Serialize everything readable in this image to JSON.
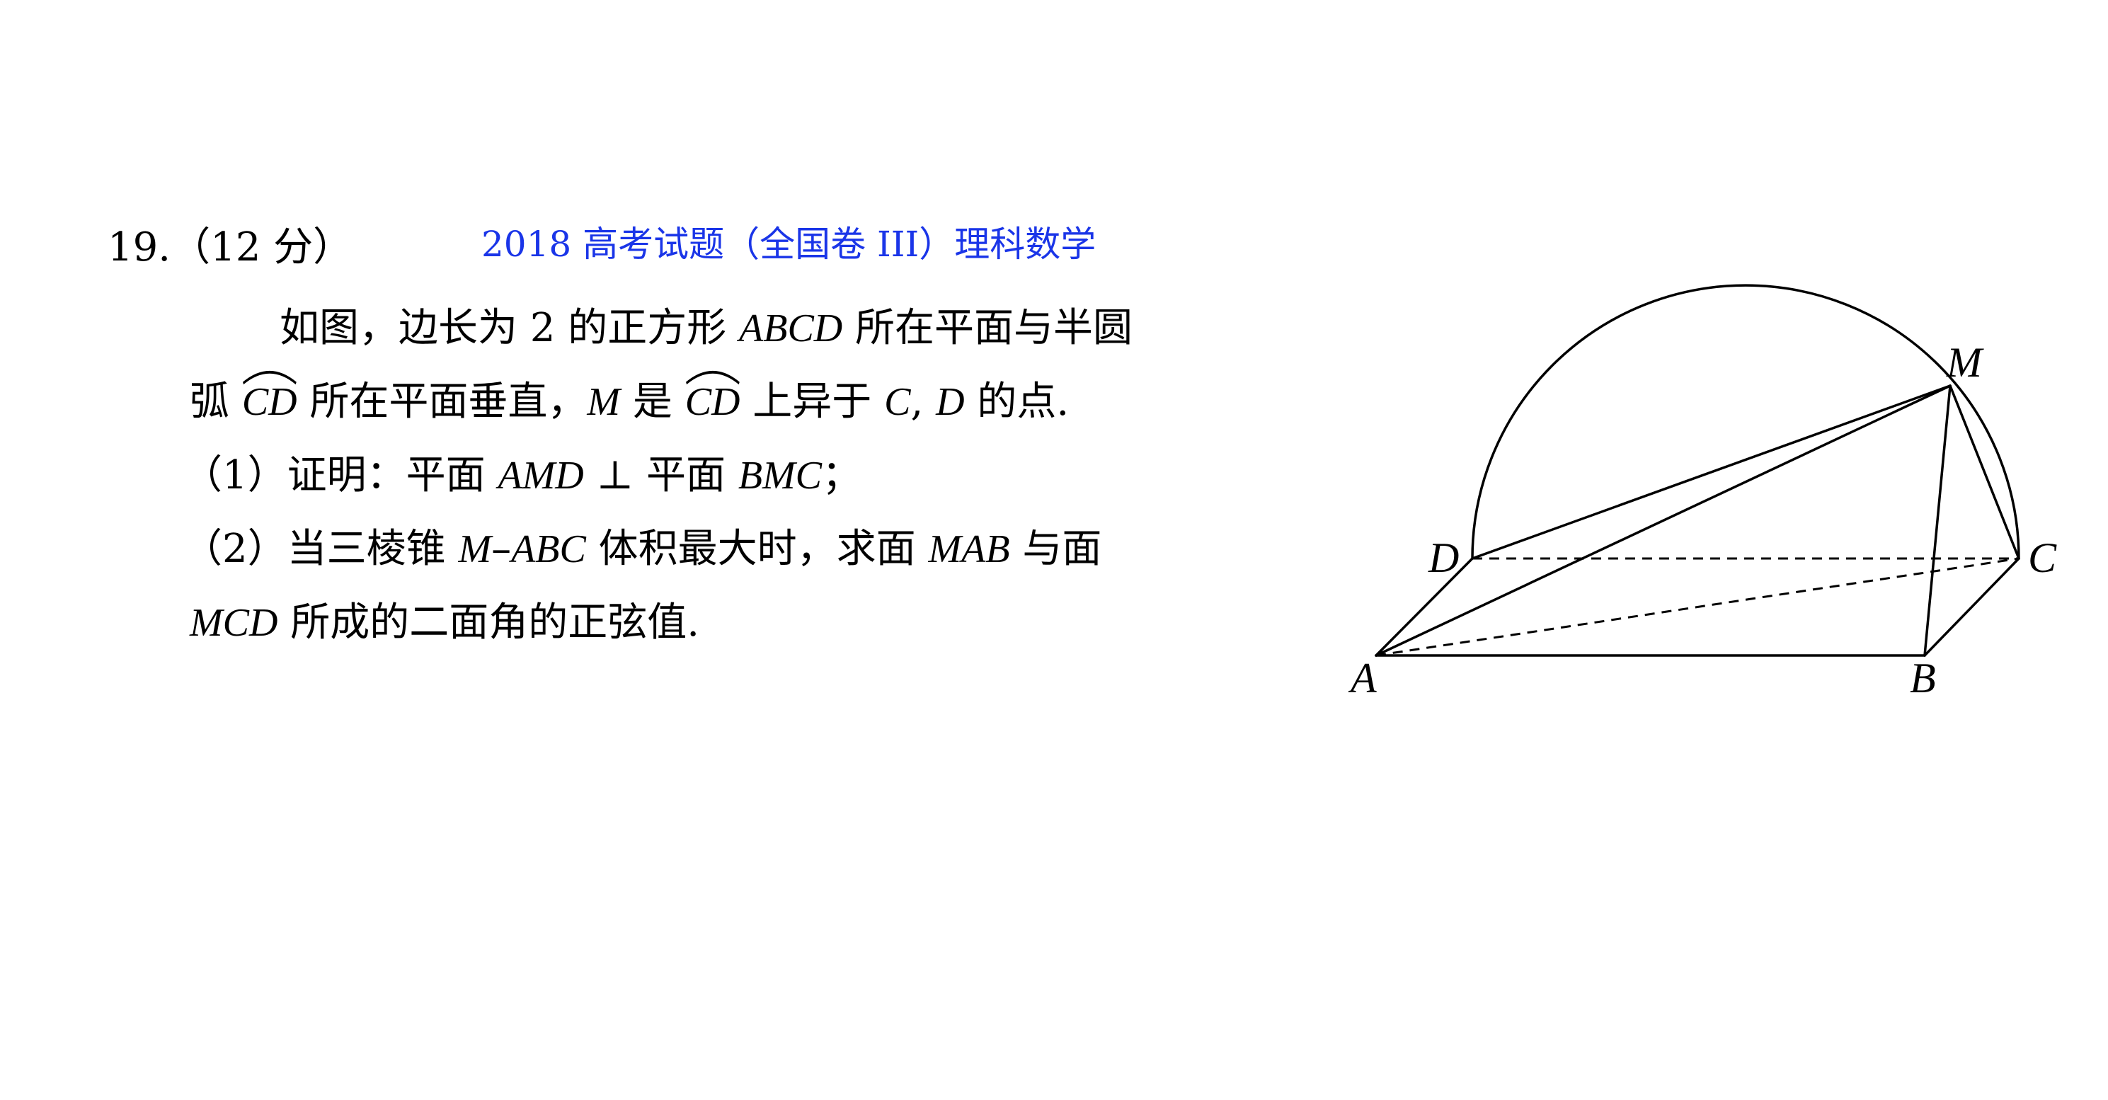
{
  "problem": {
    "number": "19.",
    "points": "（12 分）",
    "source": "2018 高考试题（全国卷 III）理科数学"
  },
  "statement": {
    "l1_a": "如图，边长为 2 的正方形 ",
    "l1_b": "ABCD",
    "l1_c": " 所在平面与半圆",
    "l2_a": "弧 ",
    "l2_b": "CD",
    "l2_c": " 所在平面垂直，",
    "l2_d": "M",
    "l2_e": " 是 ",
    "l2_f": "CD",
    "l2_g": " 上异于 ",
    "l2_h": "C",
    "l2_i": ", ",
    "l2_j": "D",
    "l2_k": " 的点."
  },
  "part1": {
    "a": "（1）证明：平面 ",
    "b": "AMD",
    "c": " ⊥ 平面 ",
    "d": "BMC",
    "e": "；"
  },
  "part2": {
    "a": "（2）当三棱锥 ",
    "b": "M",
    "c": "–",
    "d": "ABC",
    "e": " 体积最大时，求面 ",
    "f": "MAB",
    "g": " 与面",
    "h": "MCD",
    "i": " 所成的二面角的正弦值."
  },
  "figure_labels": {
    "A": "A",
    "B": "B",
    "C": "C",
    "D": "D",
    "M": "M"
  }
}
